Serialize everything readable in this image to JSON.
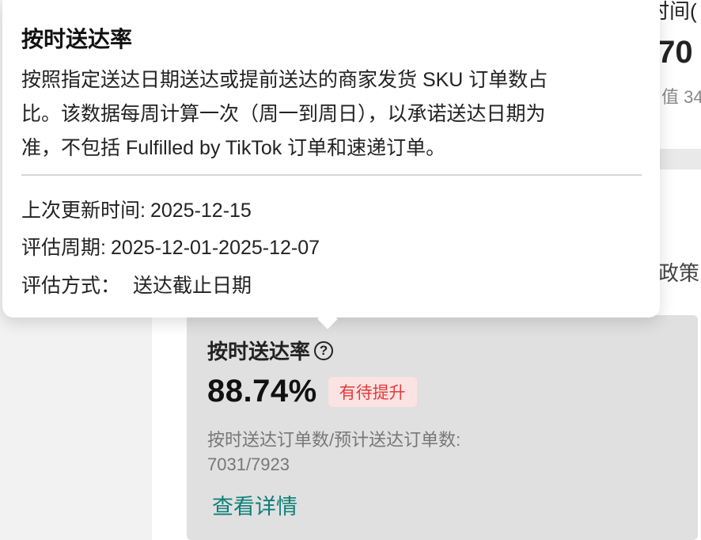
{
  "background_peek": {
    "title_partial": "时间(",
    "value_partial": ".70",
    "sub_partial": "值 34",
    "link_partial": "政策"
  },
  "metric_card": {
    "title": "按时送达率",
    "help_icon": "?",
    "value": "88.74%",
    "status_badge": "有待提升",
    "ratio_label": "按时送达订单数/预计送达订单数:",
    "ratio_value": "7031/7923",
    "detail_link": "查看详情"
  },
  "tooltip": {
    "title": "按时送达率",
    "description_lines": [
      "按照指定送达日期送达或提前送达的商家发货 SKU 订单数占",
      "比。该数据每周计算一次（周一到周日），以承诺送达日期为",
      "准，不包括 Fulfilled by TikTok 订单和速递订单。"
    ],
    "last_update_label": "上次更新时间:",
    "last_update_value": "2025-12-15",
    "period_label": "评估周期:",
    "period_value": "2025-12-01-2025-12-07",
    "method_label": "评估方式：",
    "method_value": "送达截止日期"
  },
  "colors": {
    "link": "#0d7f7a",
    "badge_text": "#e23b3b",
    "badge_bg": "#fbe3e3",
    "card_bg": "#e0e0e0"
  }
}
